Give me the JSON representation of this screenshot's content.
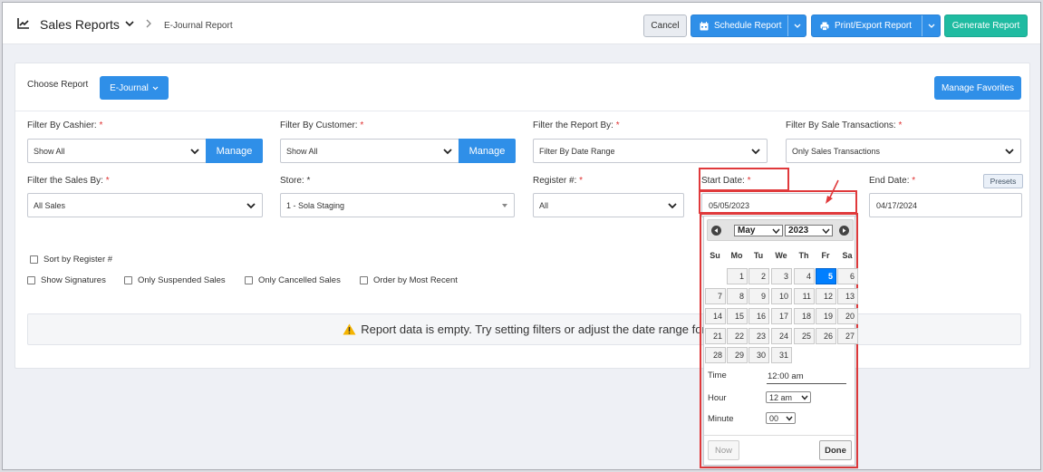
{
  "header": {
    "title": "Sales Reports",
    "breadcrumb": "E-Journal Report",
    "cancel_label": "Cancel",
    "schedule_label": "Schedule Report",
    "print_label": "Print/Export Report",
    "generate_label": "Generate Report"
  },
  "report": {
    "choose_label": "Choose Report",
    "selected_report": "E-Journal",
    "manage_favorites_label": "Manage Favorites"
  },
  "filters": {
    "cashier": {
      "label": "Filter By Cashier:",
      "value": "Show All",
      "manage_label": "Manage"
    },
    "customer": {
      "label": "Filter By Customer:",
      "value": "Show All",
      "manage_label": "Manage"
    },
    "report_by": {
      "label": "Filter the Report By:",
      "value": "Filter By Date Range"
    },
    "sale_transactions": {
      "label": "Filter By Sale Transactions:",
      "value": "Only Sales Transactions"
    },
    "sales_by": {
      "label": "Filter the Sales By:",
      "value": "All Sales"
    },
    "store": {
      "label": "Store:",
      "value": "1 - Sola Staging"
    },
    "register": {
      "label": "Register #:",
      "value": "All"
    },
    "start_date": {
      "label": "Start Date:",
      "value": "05/05/2023"
    },
    "end_date": {
      "label": "End Date:",
      "value": "04/17/2024"
    },
    "presets_label": "Presets",
    "required_mark": "*"
  },
  "options": {
    "sort_by_register": "Sort by Register #",
    "show_signatures": "Show Signatures",
    "only_suspended": "Only Suspended Sales",
    "only_cancelled": "Only Cancelled Sales",
    "order_by_recent": "Order by Most Recent"
  },
  "empty_message": "Report data is empty. Try setting filters or adjust the date range for",
  "datepicker": {
    "month": "May",
    "year": "2023",
    "weekdays": [
      "Su",
      "Mo",
      "Tu",
      "We",
      "Th",
      "Fr",
      "Sa"
    ],
    "days": [
      "1",
      "2",
      "3",
      "4",
      "5",
      "6",
      "7",
      "8",
      "9",
      "10",
      "11",
      "12",
      "13",
      "14",
      "15",
      "16",
      "17",
      "18",
      "19",
      "20",
      "21",
      "22",
      "23",
      "24",
      "25",
      "26",
      "27",
      "28",
      "29",
      "30",
      "31"
    ],
    "selected_day": "5",
    "time_label": "Time",
    "time_value": "12:00 am",
    "hour_label": "Hour",
    "hour_value": "12 am",
    "minute_label": "Minute",
    "minute_value": "00",
    "now_label": "Now",
    "done_label": "Done"
  },
  "colors": {
    "primary": "#2f8fe8",
    "success": "#1fbba1",
    "required": "#e03131",
    "annotation": "#e0393b",
    "selected_day": "#007fff"
  }
}
